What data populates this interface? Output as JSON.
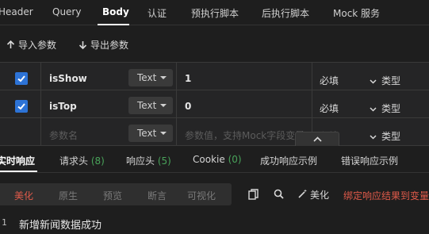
{
  "top_tabs": [
    "Header",
    "Query",
    "Body",
    "认证",
    "预执行脚本",
    "后执行脚本",
    "Mock 服务"
  ],
  "active_top_tab": "Body",
  "toolbar": {
    "import_label": "导入参数",
    "export_label": "导出参数"
  },
  "params": [
    {
      "checked": true,
      "name": "isShow",
      "type": "Text",
      "value": "1",
      "required": "必填",
      "type_select": "类型"
    },
    {
      "checked": true,
      "name": "isTop",
      "type": "Text",
      "value": "0",
      "required": "必填",
      "type_select": "类型"
    }
  ],
  "new_param": {
    "name_placeholder": "参数名",
    "type": "Text",
    "value_placeholder": "参数值，支持Mock字段变量",
    "required": "必填",
    "type_select": "类型"
  },
  "response_tabs": [
    {
      "label": "实时响应",
      "count": ""
    },
    {
      "label": "请求头",
      "count": "(8)"
    },
    {
      "label": "响应头",
      "count": "(5)"
    },
    {
      "label": "Cookie",
      "count": "(0)"
    },
    {
      "label": "成功响应示例",
      "count": ""
    },
    {
      "label": "错误响应示例",
      "count": ""
    }
  ],
  "active_response_tab": "实时响应",
  "view_options": [
    "美化",
    "原生",
    "预览",
    "断言",
    "可视化"
  ],
  "active_view_option": "美化",
  "code_toolbar": {
    "beautify_label": "美化",
    "bind_label": "绑定响应结果到变量"
  },
  "code": {
    "line_number": "1",
    "line_text": "新增新闻数据成功"
  },
  "colors": {
    "accent_red": "#e05a4a",
    "checkbox_blue": "#2d73d6",
    "count_green": "#49a35a"
  }
}
